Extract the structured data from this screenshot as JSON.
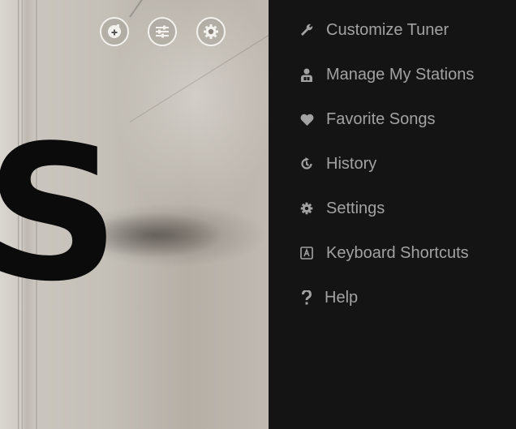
{
  "artwork": {
    "visible_letter": "S"
  },
  "player_controls": [
    {
      "name": "add-song-icon",
      "label": ""
    },
    {
      "name": "equalizer-icon",
      "label": ""
    },
    {
      "name": "gear-icon",
      "label": ""
    }
  ],
  "menu": {
    "items": [
      {
        "label": "Customize Tuner",
        "icon": "wrench-icon"
      },
      {
        "label": "Manage My Stations",
        "icon": "station-manager-icon"
      },
      {
        "label": "Favorite Songs",
        "icon": "heart-icon"
      },
      {
        "label": "History",
        "icon": "history-icon"
      },
      {
        "label": "Settings",
        "icon": "gear-icon"
      },
      {
        "label": "Keyboard Shortcuts",
        "icon": "keyboard-key-icon"
      },
      {
        "label": "Help",
        "icon": "question-mark-icon"
      }
    ]
  },
  "colors": {
    "menu_background": "#141414",
    "menu_text": "#a2a2a2",
    "control_outline": "#f4f2ef"
  }
}
